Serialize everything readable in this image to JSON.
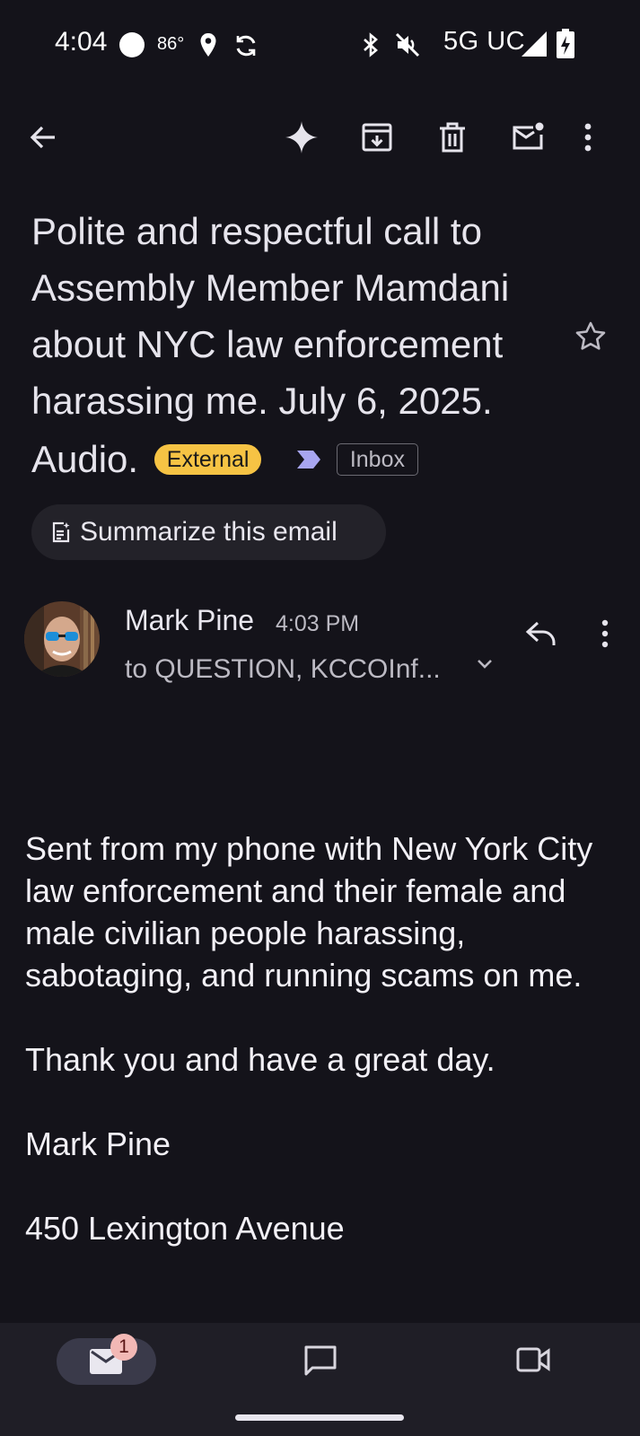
{
  "status_bar": {
    "time": "4:04",
    "temperature": "86°",
    "network": "5G UC"
  },
  "toolbar": {
    "icons": [
      "back-arrow-icon",
      "sparkle-icon",
      "archive-icon",
      "delete-icon",
      "mark-unread-icon",
      "more-vert-icon"
    ]
  },
  "email": {
    "subject": "Polite and respectful call to Assembly Member Mamdani about NYC law enforcement harassing me.  July 6, 2025. Audio.",
    "external_label": "External",
    "folder_label": "Inbox",
    "summarize_label": "Summarize this email",
    "sender_name": "Mark Pine",
    "sent_time": "4:03 PM",
    "recipients": "to QUESTION, KCCOInf...",
    "body": [
      "Sent from my phone with New York City law enforcement and their female and male civilian people harassing, sabotaging, and running scams on me.",
      "Thank you and have a great day.",
      "Mark Pine",
      "450 Lexington Avenue"
    ]
  },
  "bottom_nav": {
    "mail_badge": "1",
    "tabs": [
      "mail-icon",
      "chat-icon",
      "meet-icon"
    ]
  },
  "colors": {
    "background": "#14131a",
    "external_badge": "#f6c344",
    "importance_marker": "#a8a6f0",
    "nav_background": "#1f1e26",
    "badge": "#f2b8b5"
  }
}
